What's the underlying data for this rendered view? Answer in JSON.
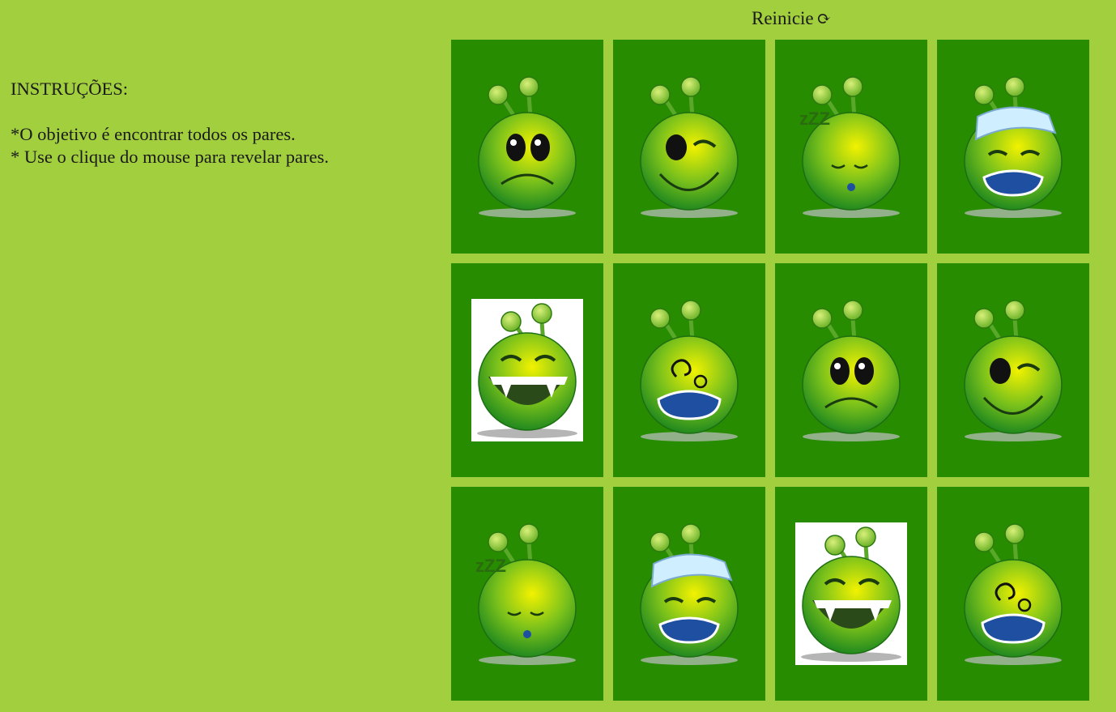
{
  "instructions": {
    "title": "INSTRUÇÕES:",
    "line1": "*O objetivo é encontrar todos os pares.",
    "line2": "* Use o clique do mouse para revelar pares."
  },
  "restart": {
    "label": "Reinicie",
    "icon": "refresh-icon"
  },
  "colors": {
    "background": "#a2cf3d",
    "card": "#278c00",
    "alien_body": "#3aa51f",
    "alien_highlight": "#f0f000"
  },
  "board": {
    "columns": 4,
    "rows": 3,
    "cards": [
      {
        "face": "sad"
      },
      {
        "face": "wink"
      },
      {
        "face": "sleepy"
      },
      {
        "face": "sick"
      },
      {
        "face": "laugh"
      },
      {
        "face": "dizzy"
      },
      {
        "face": "sad"
      },
      {
        "face": "wink"
      },
      {
        "face": "sleepy"
      },
      {
        "face": "sick"
      },
      {
        "face": "laugh"
      },
      {
        "face": "dizzy"
      }
    ]
  }
}
